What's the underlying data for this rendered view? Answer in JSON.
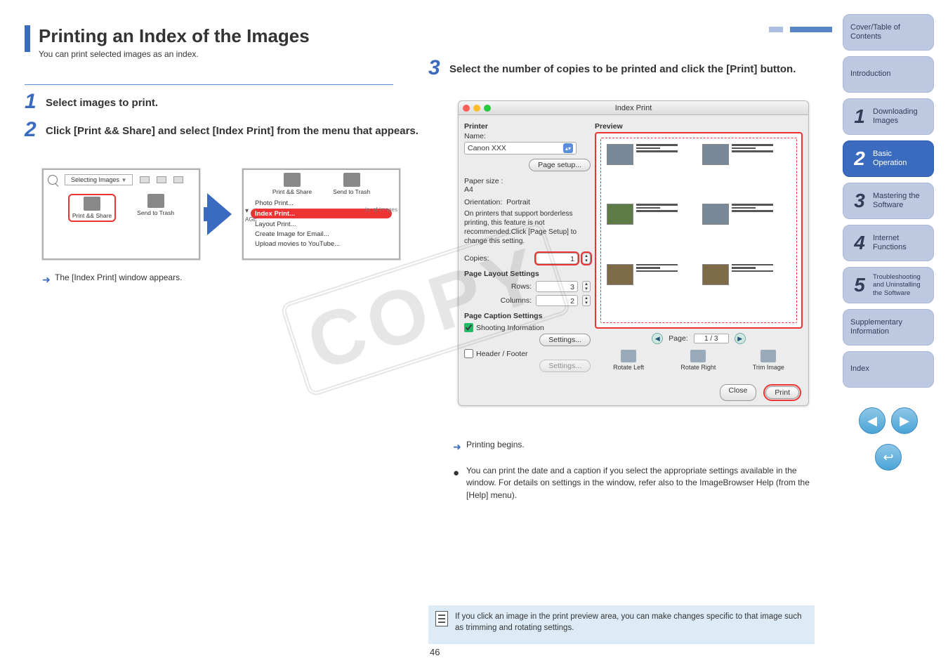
{
  "page_number": "46",
  "watermark": "COPY",
  "header": {
    "title": "Printing an Index of the Images",
    "subtitle": "You can print selected images as an index."
  },
  "steps": {
    "s1": {
      "num": "1",
      "text": "Select images to print."
    },
    "s2": {
      "num": "2",
      "text": "Click [Print && Share] and select [Index Print] from the menu that appears.",
      "selecting_label": "Selecting Images",
      "print_share": "Print && Share",
      "send_trash": "Send to Trash",
      "menu": {
        "photo": "Photo Print...",
        "index": "Index Print...",
        "layout": "Layout Print...",
        "email": "Create Image for Email...",
        "youtube": "Upload movies to YouTube..."
      },
      "no_of_images": "lo. of Images",
      "age": "AGE",
      "caption": "The [Index Print] window appears."
    },
    "s3": {
      "num": "3",
      "text": "Select the number of copies to be printed and click the [Print] button.",
      "caption": "Printing begins.",
      "bullet": "You can print the date and a caption if you select the appropriate settings available in the window. For details on settings in the window, refer also to the ImageBrowser Help (from the [Help] menu)."
    }
  },
  "index_window": {
    "title": "Index Print",
    "printer_section": "Printer",
    "name_label": "Name:",
    "printer_name": "Canon XXX",
    "page_setup": "Page setup...",
    "paper_size_label": "Paper size :",
    "paper_size": "A4",
    "orientation_label": "Orientation:",
    "orientation": "Portrait",
    "borderless_note": "On printers that support borderless printing, this feature is not recommended.Click [Page Setup] to change this setting.",
    "copies_label": "Copies:",
    "copies_value": "1",
    "layout_section": "Page Layout Settings",
    "rows_label": "Rows:",
    "rows_value": "3",
    "cols_label": "Columns:",
    "cols_value": "2",
    "caption_section": "Page Caption Settings",
    "shooting_info": "Shooting Information",
    "settings_btn": "Settings...",
    "header_footer": "Header / Footer",
    "preview_label": "Preview",
    "page_label": "Page:",
    "page_value": "1 / 3",
    "rotate_left": "Rotate Left",
    "rotate_right": "Rotate Right",
    "trim": "Trim Image",
    "close": "Close",
    "print": "Print"
  },
  "footer_note": "If you click an image in the print preview area, you can make changes specific to that image such as trimming and rotating settings.",
  "nav": {
    "items": [
      {
        "num": "",
        "label": "Cover/Table of Contents"
      },
      {
        "num": "",
        "label": "Introduction"
      },
      {
        "num": "1",
        "label": "Downloading Images"
      },
      {
        "num": "2",
        "label": "Basic Operation"
      },
      {
        "num": "3",
        "label": "Mastering the Software"
      },
      {
        "num": "4",
        "label": "Internet Functions"
      },
      {
        "num": "5",
        "label": "Troubleshooting and Uninstalling the Software"
      },
      {
        "num": "",
        "label": "Supplementary Information"
      },
      {
        "num": "",
        "label": "Index"
      }
    ]
  }
}
